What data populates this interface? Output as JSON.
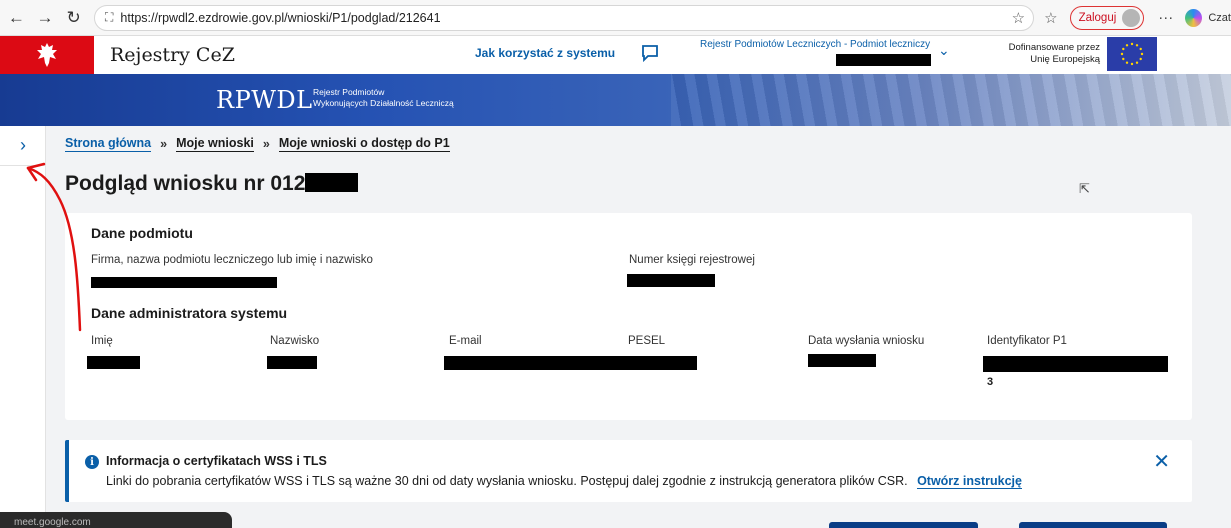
{
  "browser": {
    "url": "https://rpwdl2.ezdrowie.gov.pl/wnioski/P1/podglad/212641",
    "login_label": "Zaloguj",
    "copilot_label": "Czat"
  },
  "header": {
    "site_title": "Rejestry CeZ",
    "help_link": "Jak korzystać z systemu",
    "registry_selector": "Rejestr Podmiotów Leczniczych - Podmiot leczniczy",
    "eu_line1": "Dofinansowane przez",
    "eu_line2": "Unię Europejską"
  },
  "banner": {
    "title": "RPWDL",
    "subtitle_line1": "Rejestr Podmiotów",
    "subtitle_line2": "Wykonujących Działalność Leczniczą"
  },
  "breadcrumb": {
    "items": [
      "Strona główna",
      "Moje wnioski",
      "Moje wnioski o dostęp do P1"
    ],
    "separator": "»"
  },
  "page": {
    "title": "Podgląd wniosku nr 012"
  },
  "card": {
    "section1_title": "Dane podmiotu",
    "section1_fields": [
      "Firma, nazwa podmiotu leczniczego lub imię i nazwisko",
      "Numer księgi rejestrowej"
    ],
    "section2_title": "Dane administratora systemu",
    "section2_fields": [
      "Imię",
      "Nazwisko",
      "E-mail",
      "PESEL",
      "Data wysłania wniosku",
      "Identyfikator P1"
    ],
    "identifier_trailing": "3"
  },
  "alert": {
    "title": "Informacja o certyfikatach WSS i TLS",
    "body": "Linki do pobrania certyfikatów WSS i TLS są ważne 30 dni od daty wysłania wniosku. Postępuj dalej zgodnie z instrukcją generatora plików CSR.",
    "link": "Otwórz instrukcję"
  },
  "overlay": {
    "meet_text": "meet.google.com"
  },
  "colors": {
    "brand_blue": "#0a5fa8",
    "emblem_red": "#dc0a14",
    "annotation_red": "#e01010"
  }
}
